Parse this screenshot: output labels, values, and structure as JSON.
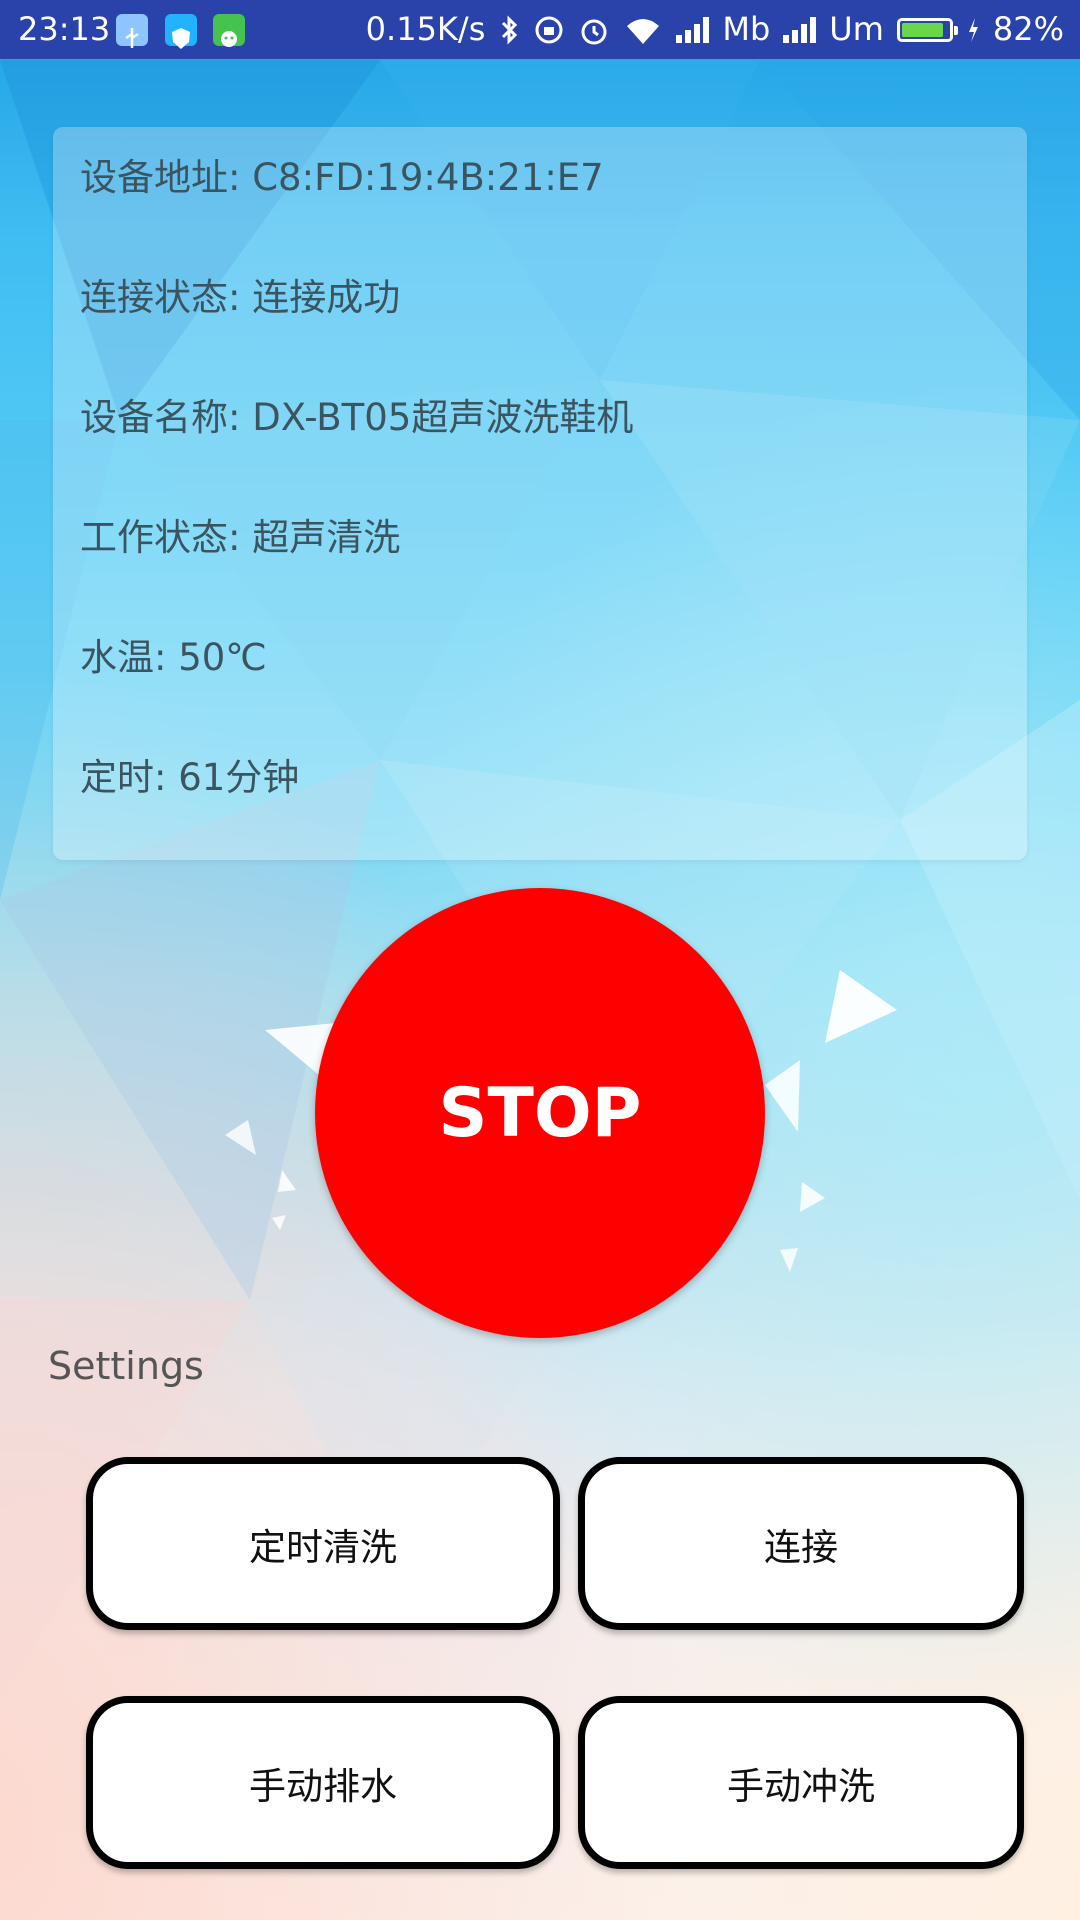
{
  "status_bar": {
    "time": "23:13",
    "network_speed": "0.15K/s",
    "carrier_1": "Mb",
    "carrier_2": "Um",
    "battery_percent": "82%",
    "icons": [
      "usb-icon",
      "shield-app-icon",
      "android-app-icon",
      "bluetooth-icon",
      "rotation-lock-icon",
      "alarm-icon",
      "wifi-icon",
      "signal-icon",
      "signal-icon",
      "battery-icon",
      "charging-icon"
    ]
  },
  "device_info": {
    "address": "设备地址: C8:FD:19:4B:21:E7",
    "connection": "连接状态: 连接成功",
    "name": "设备名称: DX-BT05超声波洗鞋机",
    "work_status": "工作状态: 超声清洗",
    "water_temp": "水温: 50℃",
    "timer": "定时: 61分钟"
  },
  "stop_button": {
    "label": "STOP",
    "color": "#ff0000"
  },
  "settings": {
    "label": "Settings",
    "buttons": [
      {
        "label": "定时清洗"
      },
      {
        "label": "连接"
      },
      {
        "label": "手动排水"
      },
      {
        "label": "手动冲洗"
      }
    ]
  },
  "colors": {
    "status_bar": "#2a43ab",
    "battery_fill": "#6ad64b",
    "info_text": "#3b5560"
  }
}
